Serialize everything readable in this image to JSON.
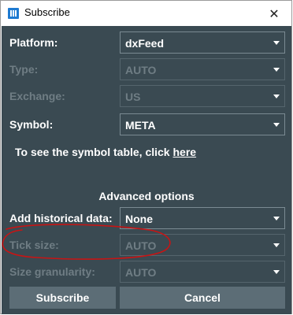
{
  "window": {
    "title": "Subscribe",
    "close_glyph": "✕"
  },
  "form": {
    "platform": {
      "label": "Platform:",
      "value": "dxFeed",
      "enabled": true
    },
    "type": {
      "label": "Type:",
      "value": "AUTO",
      "enabled": false
    },
    "exchange": {
      "label": "Exchange:",
      "value": "US",
      "enabled": false
    },
    "symbol": {
      "label": "Symbol:",
      "value": "META",
      "enabled": true
    }
  },
  "hint": {
    "text": "To see the symbol table, click ",
    "link": "here"
  },
  "advanced": {
    "title": "Advanced options",
    "historical": {
      "label": "Add historical data:",
      "value": "None",
      "enabled": true
    },
    "tick_size": {
      "label": "Tick size:",
      "value": "AUTO",
      "enabled": false
    },
    "size_granularity": {
      "label": "Size granularity:",
      "value": "AUTO",
      "enabled": false
    }
  },
  "buttons": {
    "subscribe": "Subscribe",
    "cancel": "Cancel"
  },
  "colors": {
    "panel_bg": "#3a4a52",
    "button_bg": "#5c6d76",
    "disabled_text": "#6f7d84",
    "annotation": "#c81414",
    "app_icon": "#1e7ad1"
  },
  "icons": {
    "app": "app-icon",
    "close": "close-icon",
    "dropdown": "chevron-down-icon"
  }
}
